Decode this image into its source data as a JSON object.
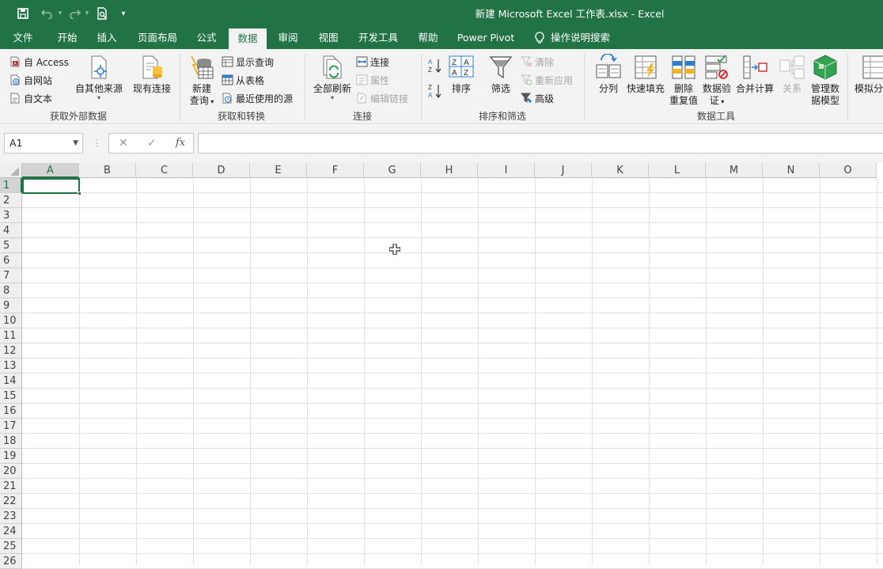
{
  "window": {
    "title": "新建 Microsoft Excel 工作表.xlsx  -  Excel",
    "accent_color": "#217346",
    "quick_access": {
      "save_icon": "save-icon",
      "undo_icon": "undo-icon",
      "redo_icon": "redo-icon",
      "preview_icon": "print-preview-icon",
      "customize_icon": "customize-qat-icon"
    }
  },
  "tabs": [
    "文件",
    "开始",
    "插入",
    "页面布局",
    "公式",
    "数据",
    "审阅",
    "视图",
    "开发工具",
    "帮助",
    "Power Pivot"
  ],
  "active_tab": "数据",
  "tell_me": "操作说明搜索",
  "ribbon": {
    "get_external_data": {
      "label": "获取外部数据",
      "access": "自 Access",
      "web": "自网站",
      "text": "自文本",
      "other": "自其他来源",
      "existing": "现有连接"
    },
    "get_transform": {
      "label": "获取和转换",
      "new_query_1": "新建",
      "new_query_2": "查询",
      "show_queries": "显示查询",
      "from_table": "从表格",
      "recent_sources": "最近使用的源"
    },
    "connections": {
      "label": "连接",
      "refresh_all": "全部刷新",
      "connections": "连接",
      "properties": "属性",
      "edit_links": "编辑链接"
    },
    "sort_filter": {
      "label": "排序和筛选",
      "sort": "排序",
      "filter": "筛选",
      "clear": "清除",
      "reapply": "重新应用",
      "advanced": "高级"
    },
    "data_tools": {
      "label": "数据工具",
      "text_to_columns": "分列",
      "flash_fill": "快速填充",
      "remove_dup_1": "删除",
      "remove_dup_2": "重复值",
      "validation_1": "数据验",
      "validation_2": "证",
      "consolidate": "合并计算",
      "relationships": "关系",
      "data_model_1": "管理数",
      "data_model_2": "据模型"
    },
    "forecast": {
      "what_if": "模拟分"
    }
  },
  "formula_bar": {
    "name_box": "A1",
    "cancel": "✕",
    "enter": "✓",
    "fx": "fx",
    "formula": ""
  },
  "sheet": {
    "columns": [
      "A",
      "B",
      "C",
      "D",
      "E",
      "F",
      "G",
      "H",
      "I",
      "J",
      "K",
      "L",
      "M",
      "N",
      "O"
    ],
    "rows": [
      "1",
      "2",
      "3",
      "4",
      "5",
      "6",
      "7",
      "8",
      "9",
      "10",
      "11",
      "12",
      "13",
      "14",
      "15",
      "16",
      "17",
      "18",
      "19",
      "20",
      "21",
      "22",
      "23",
      "24",
      "25",
      "26"
    ],
    "active_cell": "A1"
  }
}
